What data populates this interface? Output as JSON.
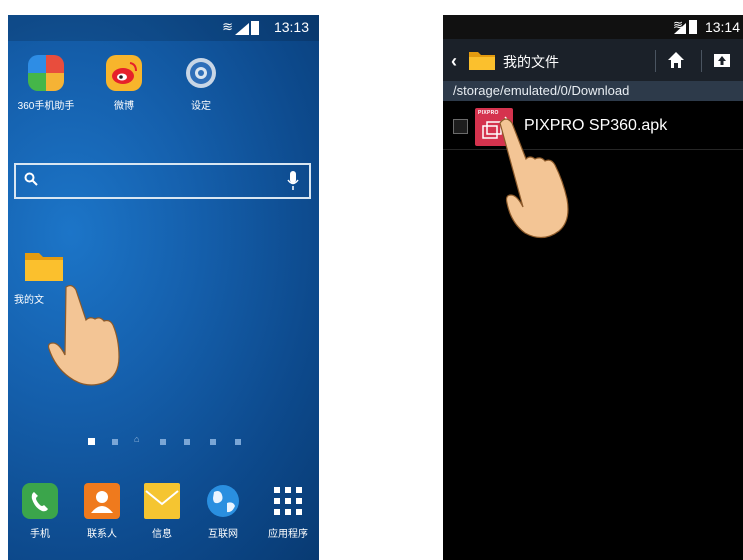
{
  "left_screen": {
    "status_bar": {
      "time": "13:13",
      "wifi_icon": "wifi-icon",
      "battery_icon": "battery-icon"
    },
    "top_apps": [
      {
        "label": "360手机助手",
        "icon": "360-assistant-icon",
        "color": "#45b649"
      },
      {
        "label": "微博",
        "icon": "weibo-icon",
        "color": "#f7b52c"
      },
      {
        "label": "设定",
        "icon": "settings-gear-icon",
        "color": "#3f87d9"
      }
    ],
    "search": {
      "icon": "search-icon",
      "mic_icon": "microphone-icon"
    },
    "folder_app": {
      "label": "我的文",
      "icon": "folder-icon"
    },
    "page_indicator": {
      "count": 7,
      "active_index": 0,
      "home_index": 2
    },
    "dock": [
      {
        "label": "手机",
        "icon": "phone-icon",
        "color": "#3ba54b"
      },
      {
        "label": "联系人",
        "icon": "contacts-icon",
        "color": "#ef7a1d"
      },
      {
        "label": "信息",
        "icon": "messages-icon",
        "color": "#f5c531"
      },
      {
        "label": "互联网",
        "icon": "internet-globe-icon",
        "color": "#2a8fe0"
      },
      {
        "label": "应用程序",
        "icon": "apps-grid-icon",
        "color": "#ffffff"
      }
    ]
  },
  "right_screen": {
    "status_bar": {
      "time": "13:14"
    },
    "action_bar": {
      "title": "我的文件",
      "back_icon": "back-chevron-icon",
      "home_icon": "home-icon",
      "up_icon": "folder-up-icon"
    },
    "path": "/storage/emulated/0/Download",
    "files": [
      {
        "name": "PIXPRO SP360.apk",
        "checked": false,
        "thumb_brand": "PIXPRO"
      }
    ]
  }
}
